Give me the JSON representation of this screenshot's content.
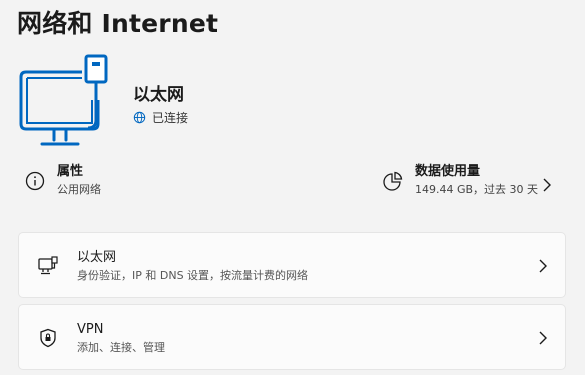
{
  "page": {
    "title": "网络和 Internet"
  },
  "connection": {
    "name": "以太网",
    "status": "已连接",
    "icon": "computer-ethernet-icon",
    "status_icon": "globe-icon",
    "accent_color": "#0067c0"
  },
  "properties": {
    "title": "属性",
    "subtitle": "公用网络",
    "icon": "info-icon"
  },
  "data_usage": {
    "title": "数据使用量",
    "subtitle": "149.44 GB，过去 30 天",
    "icon": "pie-chart-icon"
  },
  "cards": [
    {
      "title": "以太网",
      "subtitle": "身份验证，IP 和 DNS 设置，按流量计费的网络",
      "icon": "ethernet-port-icon"
    },
    {
      "title": "VPN",
      "subtitle": "添加、连接、管理",
      "icon": "shield-icon"
    }
  ]
}
